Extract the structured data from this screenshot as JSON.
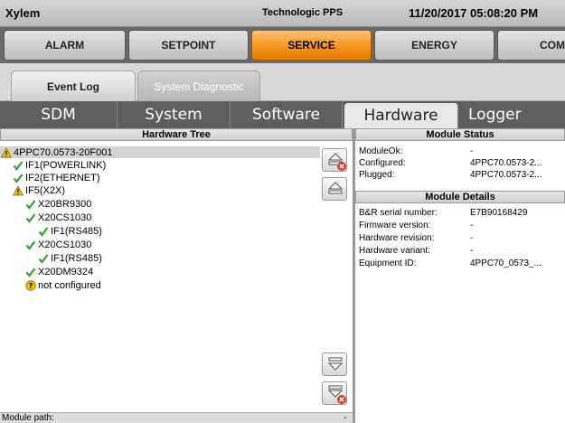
{
  "titlebar": {
    "app": "Xylem",
    "product": "Technologic PPS",
    "datetime": "11/20/2017 05:08:20 PM"
  },
  "main_tabs": [
    {
      "label": "ALARM",
      "active": false
    },
    {
      "label": "SETPOINT",
      "active": false
    },
    {
      "label": "SERVICE",
      "active": true
    },
    {
      "label": "ENERGY",
      "active": false
    },
    {
      "label": "COM",
      "active": false
    }
  ],
  "sub_tabs": {
    "event_log": "Event Log",
    "system_diagnostic": "System Diagnostic"
  },
  "diag_tabs": [
    {
      "label": "SDM",
      "active": false
    },
    {
      "label": "System",
      "active": false
    },
    {
      "label": "Software",
      "active": false
    },
    {
      "label": "Hardware",
      "active": true
    },
    {
      "label": "Logger",
      "active": false
    }
  ],
  "hardware_tree": {
    "header": "Hardware Tree",
    "nodes": [
      {
        "label": "4PPC70.0573-20F001",
        "icon": "warning-icon",
        "selected": true
      },
      {
        "label": "IF1(POWERLINK)",
        "icon": "check-icon",
        "selected": false
      },
      {
        "label": "IF2(ETHERNET)",
        "icon": "check-icon",
        "selected": false
      },
      {
        "label": "IF5(X2X)",
        "icon": "warning-icon",
        "selected": false
      },
      {
        "label": "X20BR9300",
        "icon": "check-icon",
        "selected": false
      },
      {
        "label": "X20CS1030",
        "icon": "check-icon",
        "selected": false
      },
      {
        "label": "IF1(RS485)",
        "icon": "check-icon",
        "selected": false
      },
      {
        "label": "X20CS1030",
        "icon": "check-icon",
        "selected": false
      },
      {
        "label": "IF1(RS485)",
        "icon": "check-icon",
        "selected": false
      },
      {
        "label": "X20DM9324",
        "icon": "check-icon",
        "selected": false
      },
      {
        "label": "not configured",
        "icon": "question-icon",
        "selected": false
      }
    ]
  },
  "module_status": {
    "header": "Module Status",
    "rows": [
      {
        "key": "ModuleOk:",
        "value": "-"
      },
      {
        "key": "Configured:",
        "value": "4PPC70.0573-2..."
      },
      {
        "key": "Plugged:",
        "value": "4PPC70.0573-2..."
      }
    ]
  },
  "module_details": {
    "header": "Module Details",
    "rows": [
      {
        "key": "B&R serial number:",
        "value": "E7B90168429"
      },
      {
        "key": "Firmware version:",
        "value": "-"
      },
      {
        "key": "Hardware revision:",
        "value": "-"
      },
      {
        "key": "Hardware variant:",
        "value": "-"
      },
      {
        "key": "Equipment ID:",
        "value": "4PPC70_0573_..."
      }
    ]
  },
  "status_bar": {
    "label": "Module path:",
    "value": "-"
  },
  "colors": {
    "active_tab": "#f7941d",
    "ok": "#2ca52c",
    "warning": "#f2c200",
    "error": "#d63b2a"
  }
}
